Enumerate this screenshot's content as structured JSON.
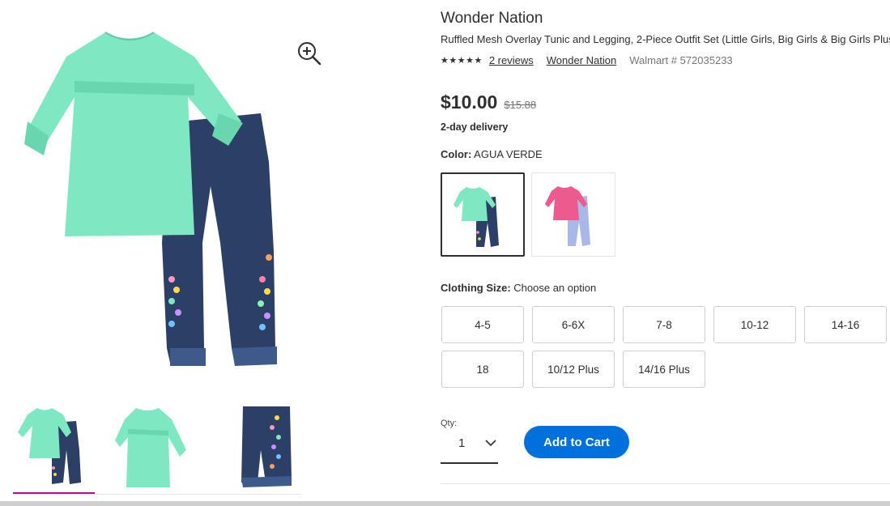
{
  "product": {
    "brand": "Wonder Nation",
    "title": "Ruffled Mesh Overlay Tunic and Legging, 2-Piece Outfit Set (Little Girls, Big Girls & Big Girls Plus",
    "stars": "★★★★★",
    "reviews_link": "2 reviews",
    "brand_link": "Wonder Nation",
    "sku": "Walmart # 572035233",
    "price": "$10.00",
    "was_price": "$15.88",
    "delivery": "2-day delivery"
  },
  "color": {
    "label": "Color:",
    "value": " AGUA VERDE",
    "swatches": [
      {
        "top": "#7de8c2",
        "bottom": "#2c3f66",
        "selected": true
      },
      {
        "top": "#ec5a8e",
        "bottom": "#a9b8e6",
        "selected": false
      }
    ]
  },
  "size": {
    "label": "Clothing Size:",
    "value": " Choose an option",
    "options": [
      "4-5",
      "6-6X",
      "7-8",
      "10-12",
      "14-16",
      "18",
      "10/12 Plus",
      "14/16 Plus"
    ]
  },
  "quantity": {
    "label": "Qty:",
    "value": "1"
  },
  "cart": {
    "add_label": "Add to Cart"
  },
  "icons": {
    "zoom": "zoom-in-icon",
    "chevron": "chevron-down-icon"
  },
  "colors": {
    "accent_blue": "#0071dc",
    "thumb_indicator": "#c00b8c",
    "tunic": "#7de8c2",
    "leggings": "#2c3f66"
  }
}
